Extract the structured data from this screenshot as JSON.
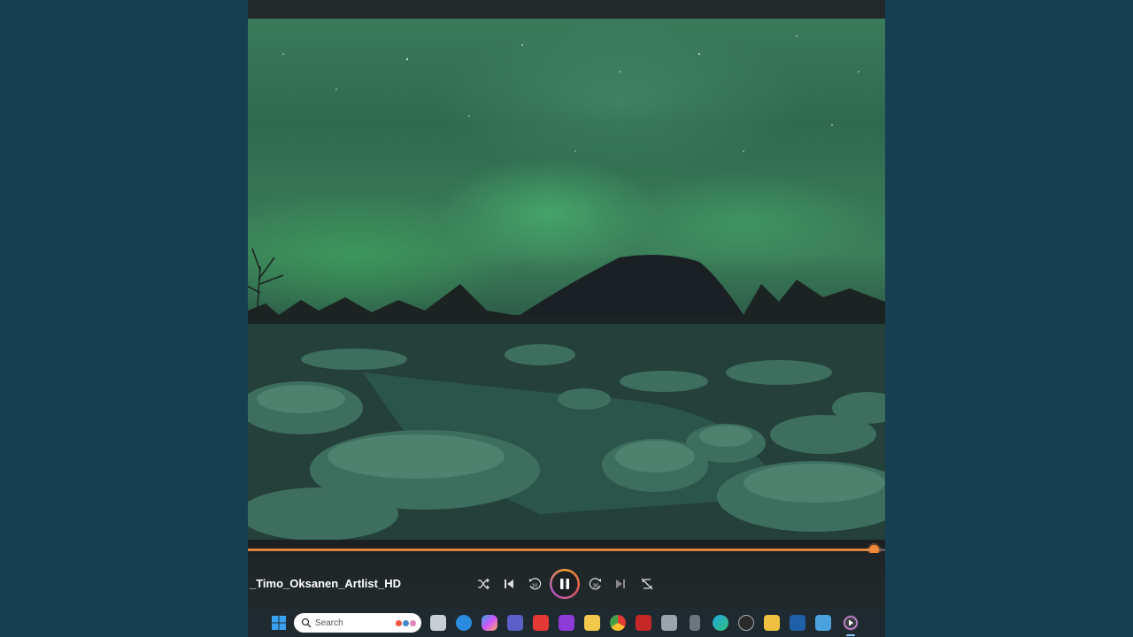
{
  "media": {
    "title": "_Timo_Oksanen_Artlist_HD",
    "progress": 0.983
  },
  "controls": {
    "shuffle": "shuffle-icon",
    "previous": "previous-icon",
    "rewind": "rewind-10-icon",
    "rewind_label": "10",
    "play_pause": "pause-icon",
    "forward": "forward-30-icon",
    "forward_label": "30",
    "next": "next-icon",
    "repeat": "repeat-off-icon"
  },
  "taskbar": {
    "search_placeholder": "Search",
    "apps": [
      "start-icon",
      "task-view-icon",
      "widgets-icon",
      "copilot-icon",
      "teams-icon",
      "media-player-icon",
      "app-icon",
      "file-explorer-icon",
      "chrome-icon",
      "mcafee-icon",
      "camera-icon",
      "device-icon",
      "edge-icon",
      "obs-icon",
      "app-icon",
      "app-icon",
      "notepad-icon",
      "media-player-active-icon"
    ]
  },
  "colors": {
    "background": "#173f52",
    "accent": "#e0843c",
    "taskbar": "#1f2a30"
  }
}
